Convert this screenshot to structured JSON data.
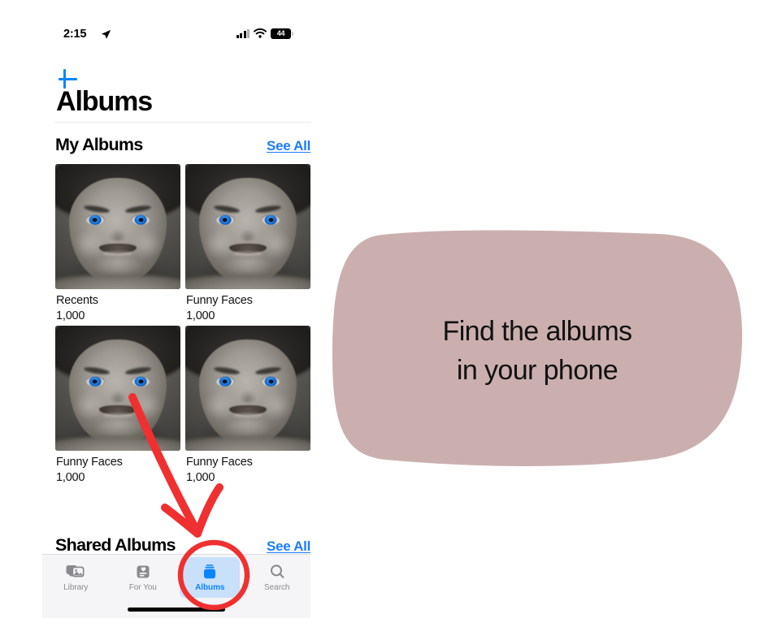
{
  "status_bar": {
    "time": "2:15",
    "location_icon": "location-arrow-icon",
    "cellular_icon": "cellular-signal-icon",
    "wifi_icon": "wifi-icon",
    "battery_percent": "44"
  },
  "nav": {
    "add_icon": "plus-icon",
    "title": "Albums"
  },
  "sections": [
    {
      "title": "My Albums",
      "see_all_label": "See All",
      "albums": [
        {
          "name": "Recents",
          "count": "1,000",
          "thumb": "baby-funny-face-photo"
        },
        {
          "name": "Funny Faces",
          "count": "1,000",
          "thumb": "baby-funny-face-photo"
        },
        {
          "name": "Funny Faces",
          "count": "1,000",
          "thumb": "baby-funny-face-photo"
        },
        {
          "name": "Funny Faces",
          "count": "1,000",
          "thumb": "baby-funny-face-photo"
        }
      ]
    },
    {
      "title": "Shared Albums",
      "see_all_label": "See All"
    }
  ],
  "tab_bar": {
    "tabs": [
      {
        "label": "Library",
        "icon": "photo-stack-icon",
        "active": false
      },
      {
        "label": "For You",
        "icon": "for-you-card-icon",
        "active": false
      },
      {
        "label": "Albums",
        "icon": "albums-stack-icon",
        "active": true
      },
      {
        "label": "Search",
        "icon": "magnifier-icon",
        "active": false
      }
    ]
  },
  "annotations": {
    "callout": {
      "line1": "Find the albums",
      "line2": "in your phone",
      "fill_color": "#cbafaf",
      "text_color": "#111111"
    },
    "arrow": {
      "color": "#f03030",
      "points_to": "albums-tab"
    },
    "highlight_circle": {
      "color": "#f03030",
      "around": "albums-tab"
    }
  },
  "colors": {
    "accent_blue": "#0a84ff",
    "link_blue": "#1a7cff",
    "tab_highlight": "#c9e0fb",
    "tab_bar_bg": "#f5f5f7",
    "inactive_gray": "#8a8a8e"
  }
}
